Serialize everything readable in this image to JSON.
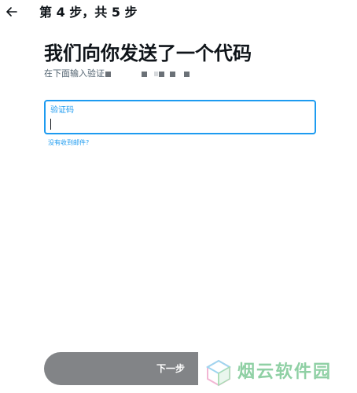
{
  "header": {
    "step_label": "第 4 步，共 5 步"
  },
  "main": {
    "title": "我们向你发送了一个代码",
    "subtitle": "在下面输入验证"
  },
  "code_field": {
    "label": "验证码",
    "value": ""
  },
  "help_link": "没有收到邮件?",
  "footer": {
    "next_label": "下一步"
  },
  "watermark": {
    "text": "烟云软件园"
  },
  "colors": {
    "accent": "#1d9bf0",
    "button": "#828487",
    "watermark": "#8fd0a4"
  }
}
